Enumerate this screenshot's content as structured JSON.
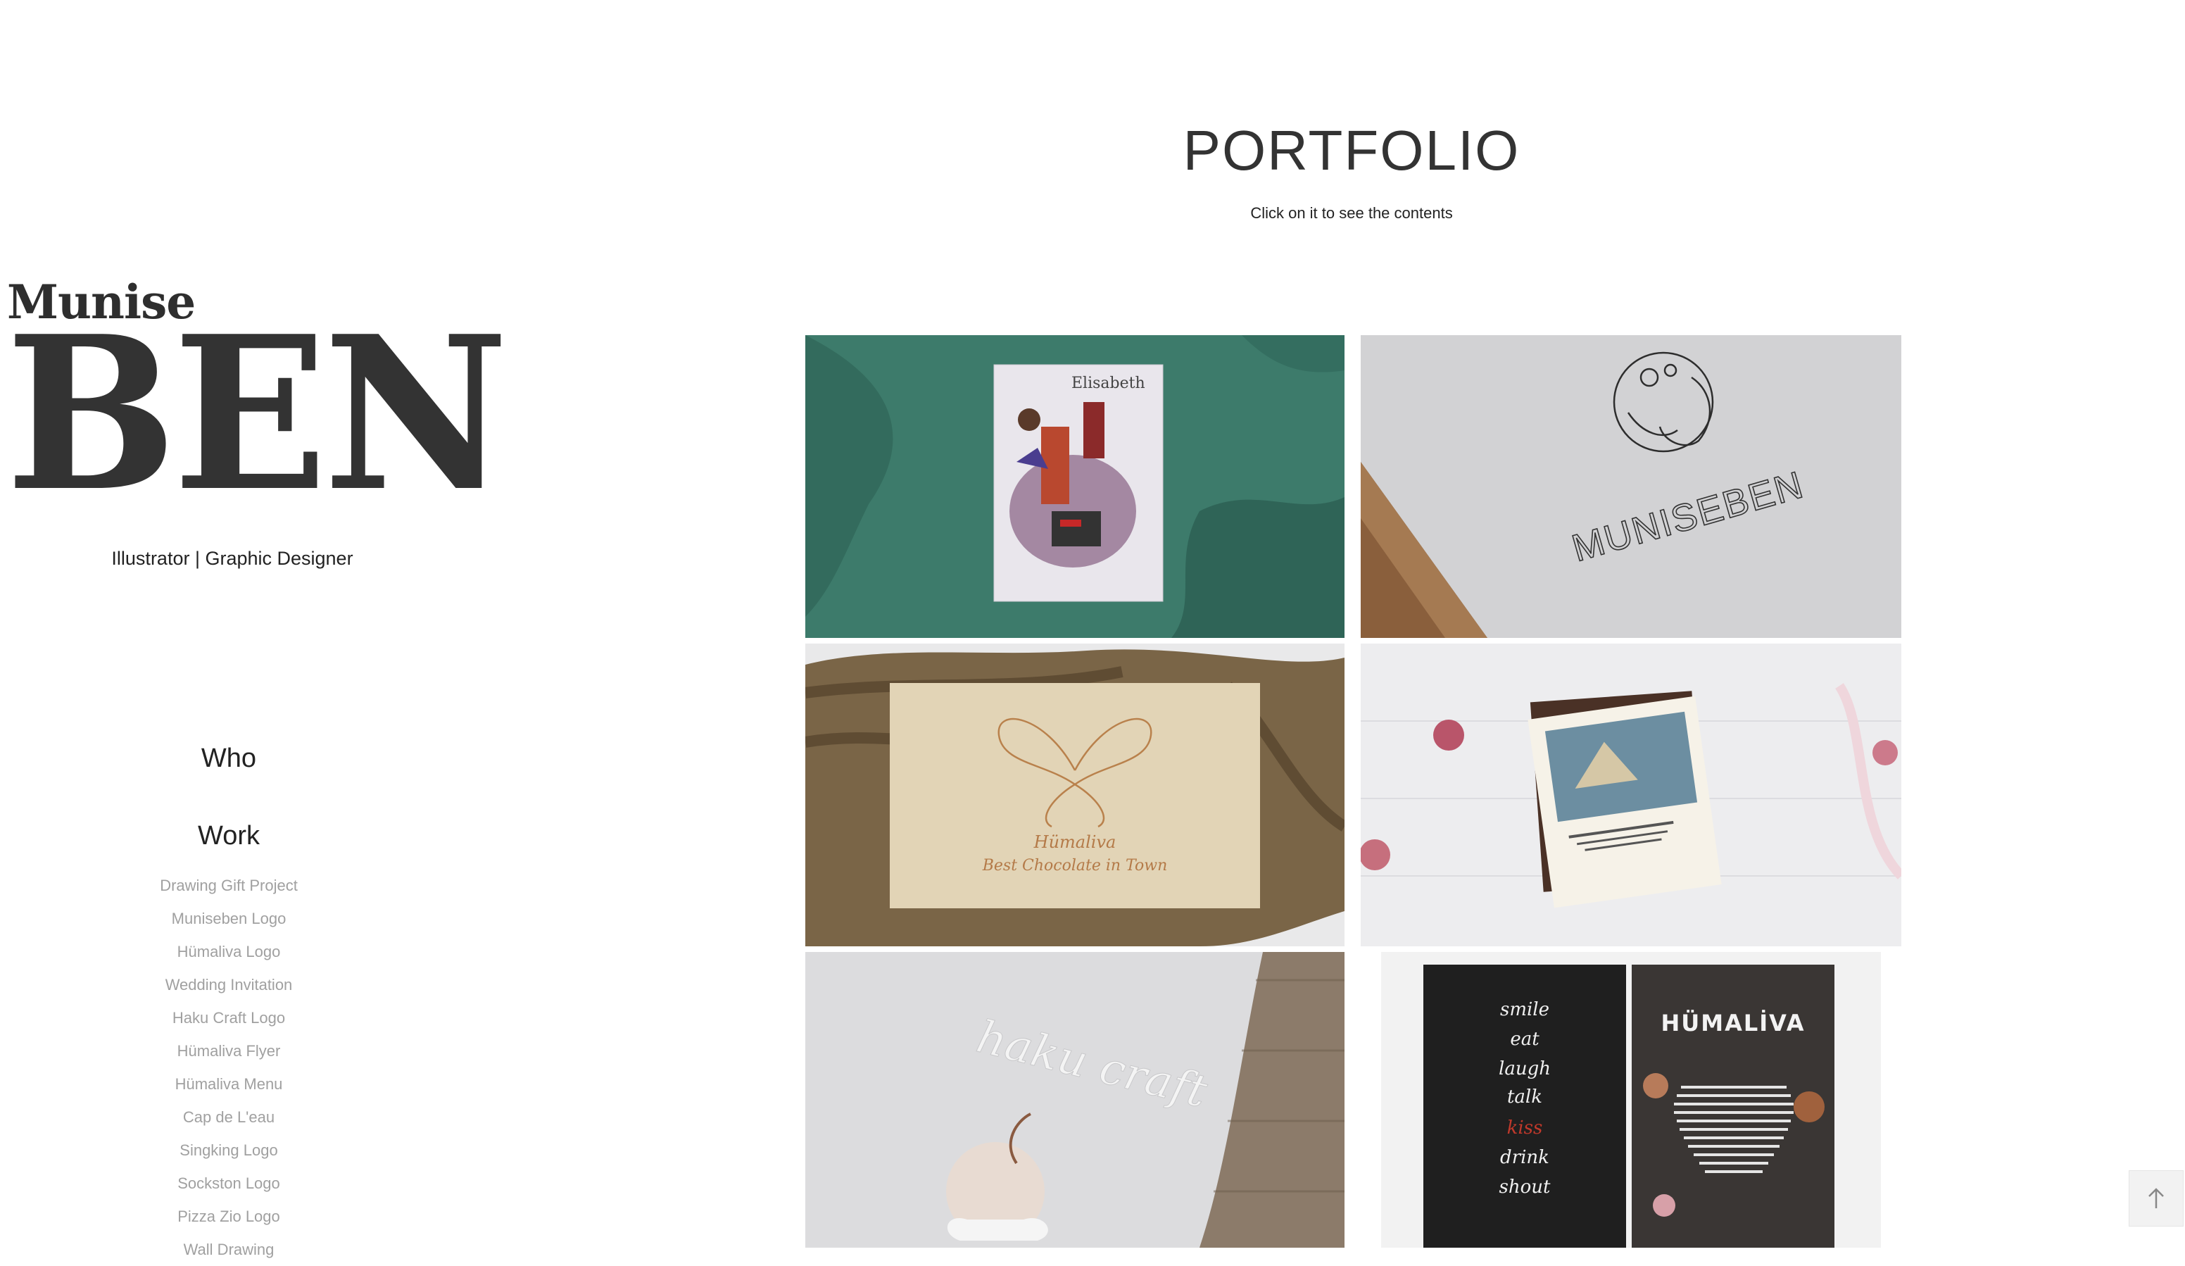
{
  "brand": {
    "first_name": "Munise",
    "last_name": "BEN",
    "tagline": "Illustrator | Graphic Designer"
  },
  "nav": {
    "who": "Who",
    "work": "Work",
    "work_items": [
      "Drawing Gift Project",
      "Muniseben Logo",
      "Hümaliva Logo",
      "Wedding Invitation",
      "Haku Craft Logo",
      "Hümaliva Flyer",
      "Hümaliva Menu",
      "Cap de L'eau",
      "Singking Logo",
      "Sockston Logo",
      "Pizza Zio Logo",
      "Wall Drawing"
    ]
  },
  "header": {
    "title": "PORTFOLIO",
    "subtitle": "Click on it to see the contents"
  },
  "tiles": {
    "t1_text": "Elisabeth",
    "t2_text": "MUNISEBEN",
    "t3_line1": "Hümaliva",
    "t3_line2": "Best Chocolate in Town",
    "t5_text": "haku craft",
    "t6_words": [
      "smile",
      "eat",
      "laugh",
      "talk",
      "kiss",
      "drink",
      "shout"
    ],
    "t6_title": "HÜMALİVA"
  },
  "colors": {
    "green_backdrop": "#3c7a6a",
    "nav_active": "#222222",
    "nav_muted": "#a0a0a0",
    "accent_kiss": "#c0392b"
  },
  "icons": {
    "scroll_top": "arrow-up-icon"
  }
}
